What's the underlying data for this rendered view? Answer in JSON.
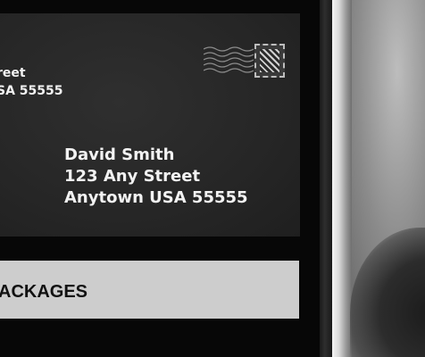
{
  "envelope": {
    "return_address": {
      "line1": "reet",
      "line2": "SA 55555"
    },
    "recipient": {
      "name": "David Smith",
      "street": "123 Any Street",
      "city_line": "Anytown USA 55555"
    },
    "postmark_icon": "postmark-wavy-lines",
    "stamp_icon": "postage-stamp"
  },
  "service_bar": {
    "label": "ACKAGES"
  },
  "photo": {
    "description_icon": "grayscale-photo"
  }
}
